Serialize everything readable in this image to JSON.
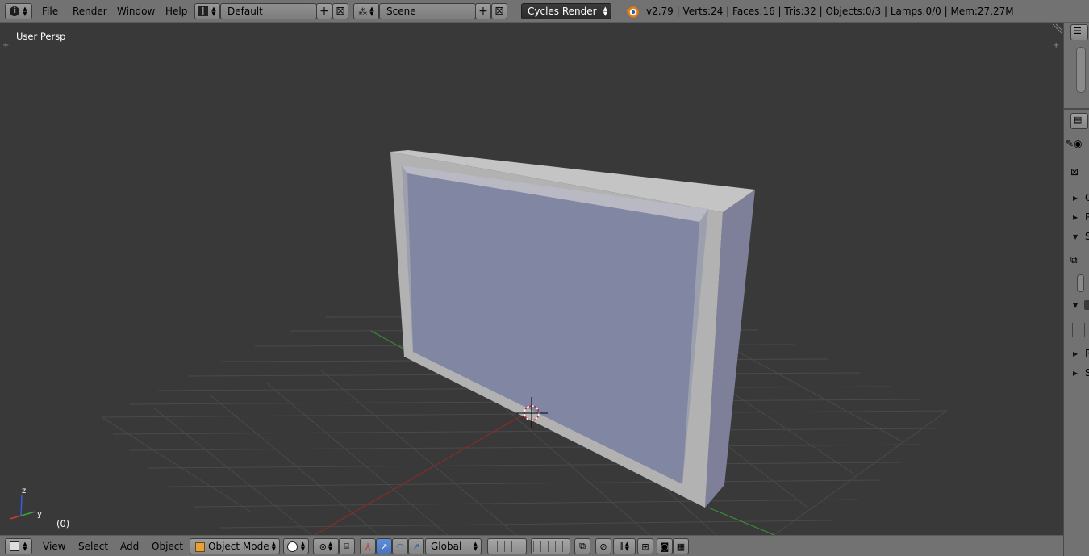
{
  "header": {
    "menus": [
      "File",
      "Render",
      "Window",
      "Help"
    ],
    "layout_name": "Default",
    "scene_name": "Scene",
    "render_engine": "Cycles Render",
    "stats": "v2.79 | Verts:24 | Faces:16 | Tris:32 | Objects:0/3 | Lamps:0/0 | Mem:27.27M"
  },
  "viewport": {
    "view_label": "User Persp",
    "frame_label": "(0)",
    "axis_labels": [
      "z",
      "y"
    ]
  },
  "footer": {
    "menus": [
      "View",
      "Select",
      "Add",
      "Object"
    ],
    "mode": "Object Mode",
    "orientation": "Global"
  },
  "properties_panel": {
    "section_letters": [
      "C",
      "P",
      "S",
      "R",
      "S"
    ]
  },
  "colors": {
    "header_bg": "#727272",
    "viewport_bg": "#393939",
    "screen_face": "#8186a3",
    "frame_face": "#b2b2b2",
    "x_axis": "#8b2a2a",
    "y_axis": "#3a8a3a",
    "active_button": "#5f8ed8"
  }
}
